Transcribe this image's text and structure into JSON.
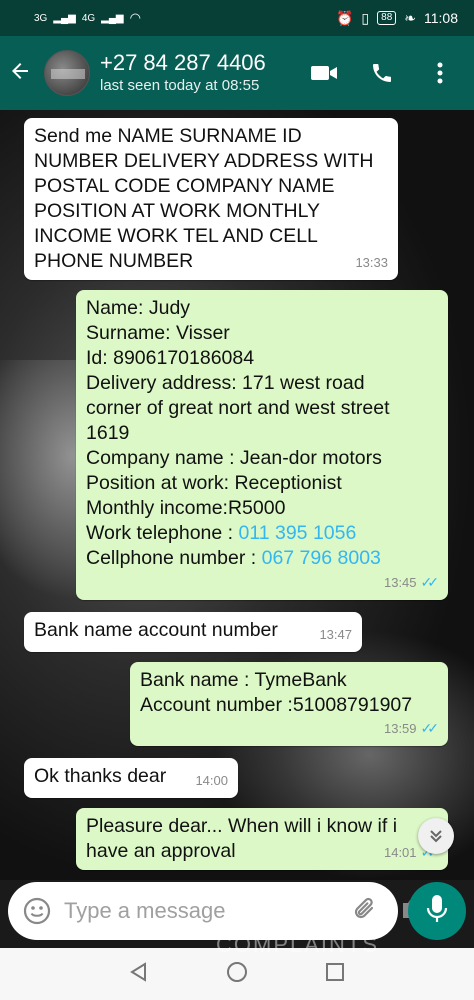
{
  "status_bar": {
    "signal_left": "3G",
    "signal_right": "4G",
    "battery": "88",
    "time": "11:08"
  },
  "header": {
    "contact_name": "+27 84 287 4406",
    "last_seen": "last seen today at 08:55"
  },
  "messages": [
    {
      "direction": "incoming",
      "text": "Send me NAME SURNAME ID NUMBER DELIVERY ADDRESS WITH POSTAL CODE COMPANY NAME POSITION AT WORK MONTHLY INCOME WORK TEL AND CELL PHONE NUMBER",
      "time": "13:33"
    },
    {
      "direction": "outgoing",
      "lines": {
        "name": "Name: Judy",
        "surname": "Surname: Visser",
        "id": "Id: 8906170186084",
        "address1": "Delivery address: 171 west road",
        "address2": "corner of great nort and west street",
        "address3": "1619",
        "company": "Company name : Jean-dor motors",
        "position": "Position at work: Receptionist",
        "income": "Monthly income:R5000",
        "work_tel_label": "Work telephone : ",
        "work_tel_value": "011 395 1056",
        "cell_label": "Cellphone number : ",
        "cell_value": "067 796 8003"
      },
      "time": "13:45",
      "ticks": "✓✓"
    },
    {
      "direction": "incoming",
      "text": "Bank name account number",
      "time": "13:47"
    },
    {
      "direction": "outgoing",
      "text": "Bank name : TymeBank\nAccount number :51008791907",
      "time": "13:59",
      "ticks": "✓✓"
    },
    {
      "direction": "incoming",
      "text": "Ok thanks dear",
      "time": "14:00"
    },
    {
      "direction": "outgoing",
      "text": "Pleasure dear... When will i know if i\nhave an approval",
      "time": "14:01",
      "ticks": "✓✓"
    }
  ],
  "input": {
    "placeholder": "Type a message"
  },
  "watermark": "COMPLAINTS",
  "icons": {
    "back": "arrow-left-icon",
    "video": "video-call-icon",
    "call": "phone-icon",
    "menu": "more-vert-icon",
    "emoji": "emoji-icon",
    "attach": "paperclip-icon",
    "camera": "camera-icon",
    "mic": "mic-icon",
    "scroll": "chevron-double-down-icon"
  },
  "colors": {
    "header": "#075e54",
    "status_bar": "#073e36",
    "incoming_bubble": "#ffffff",
    "outgoing_bubble": "#dcf8c6",
    "tick_blue": "#34b7f1",
    "mic_button": "#00897b"
  }
}
